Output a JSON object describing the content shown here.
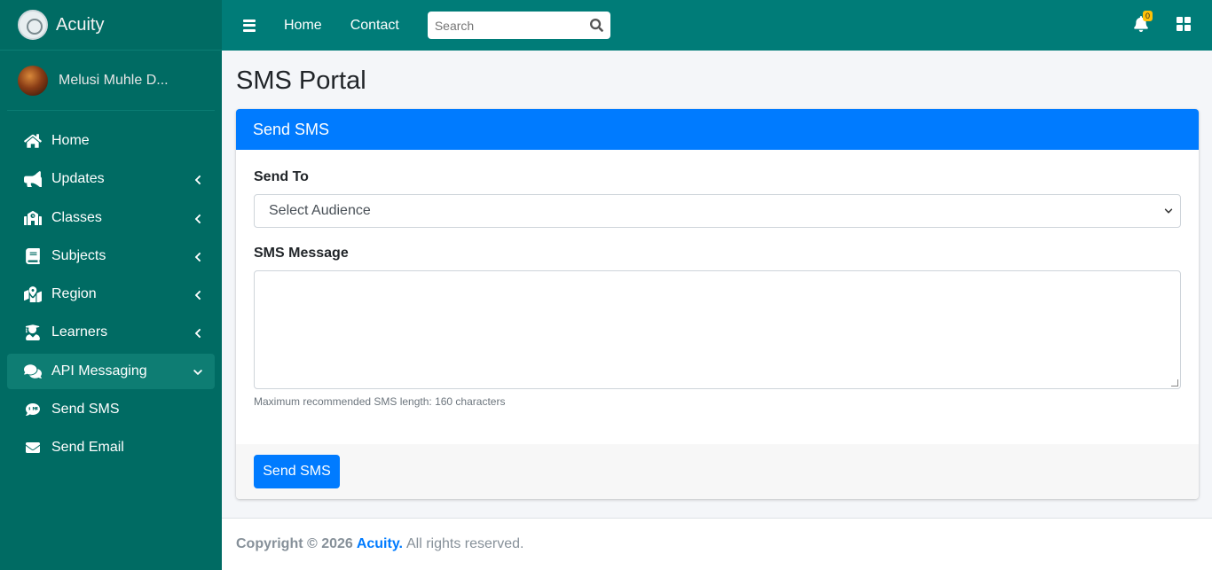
{
  "sidebar": {
    "brand": "Acuity",
    "user": "Melusi Muhle D...",
    "items": [
      {
        "label": "Home",
        "icon": "home-icon",
        "chevron": ""
      },
      {
        "label": "Updates",
        "icon": "megaphone-icon",
        "chevron": "left"
      },
      {
        "label": "Classes",
        "icon": "school-icon",
        "chevron": "left"
      },
      {
        "label": "Subjects",
        "icon": "book-icon",
        "chevron": "left"
      },
      {
        "label": "Region",
        "icon": "map-marker-icon",
        "chevron": "left"
      },
      {
        "label": "Learners",
        "icon": "graduate-icon",
        "chevron": "left"
      },
      {
        "label": "API Messaging",
        "icon": "comments-icon",
        "chevron": "down"
      },
      {
        "label": "Send SMS",
        "icon": "sms-icon",
        "chevron": ""
      },
      {
        "label": "Send Email",
        "icon": "envelope-icon",
        "chevron": ""
      }
    ]
  },
  "topbar": {
    "links": [
      "Home",
      "Contact"
    ],
    "search_placeholder": "Search",
    "notification_count": "0"
  },
  "main": {
    "title": "SMS Portal",
    "card_title": "Send SMS",
    "send_to_label": "Send To",
    "select_value": "Select Audience",
    "message_label": "SMS Message",
    "message_value": "",
    "hint": "Maximum recommended SMS length: 160 characters",
    "submit_label": "Send SMS"
  },
  "footer": {
    "copyright": "Copyright © 2026",
    "brand": "Acuity.",
    "rest": "All rights reserved."
  },
  "colors": {
    "sidebar": "#006b63",
    "topbar": "#007c78",
    "primary": "#007bff",
    "badge": "#ffc107"
  }
}
